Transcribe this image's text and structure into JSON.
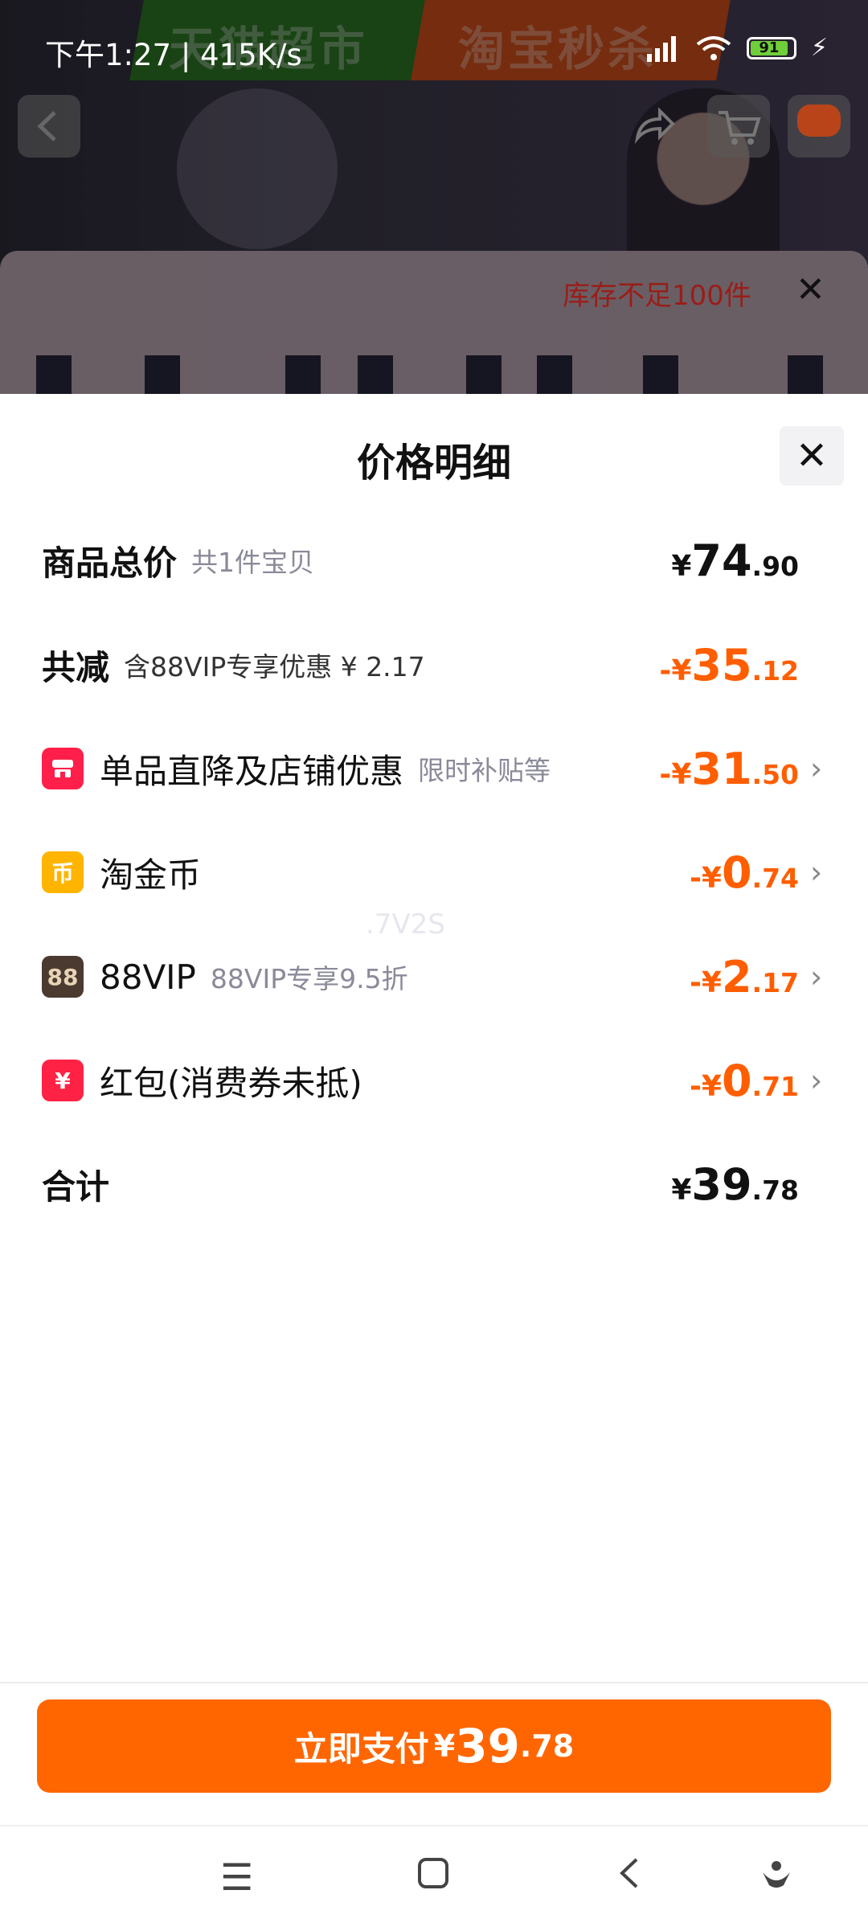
{
  "status": {
    "time": "下午1:27",
    "speed": "415K/s",
    "battery": "91"
  },
  "background": {
    "banner_left": "天猫超市",
    "banner_right": "淘宝秒杀",
    "sku_notice": "库存不足100件"
  },
  "sheet": {
    "title": "价格明细"
  },
  "rows": {
    "total": {
      "label": "商品总价",
      "sub": "共1件宝贝",
      "cur": "¥",
      "int": "74",
      "dec": ".90"
    },
    "discount": {
      "label": "共减",
      "sub": "含88VIP专享优惠 ¥ 2.17",
      "cur": "-¥",
      "int": "35",
      "dec": ".12"
    },
    "store": {
      "label": "单品直降及店铺优惠",
      "sub": "限时补贴等",
      "cur": "-¥",
      "int": "31",
      "dec": ".50"
    },
    "coin": {
      "label": "淘金币",
      "icon_text": "币",
      "cur": "-¥",
      "int": "0",
      "dec": ".74"
    },
    "vip": {
      "label": "88VIP",
      "sub": "88VIP专享9.5折",
      "icon_text": "88",
      "cur": "-¥",
      "int": "2",
      "dec": ".17"
    },
    "redpacket": {
      "label": "红包(消费券未抵)",
      "icon_text": "¥",
      "cur": "-¥",
      "int": "0",
      "dec": ".71"
    },
    "sum": {
      "label": "合计",
      "cur": "¥",
      "int": "39",
      "dec": ".78"
    }
  },
  "watermark": ".7V2S",
  "pay": {
    "label": "立即支付",
    "cur": "¥",
    "int": "39",
    "dec": ".78"
  },
  "colors": {
    "accent": "#ff6600",
    "discount": "#ff5e00"
  },
  "icons": [
    "back-icon",
    "share-icon",
    "cart-icon",
    "more-icon",
    "close-icon",
    "chevron-right-icon",
    "menu-icon",
    "home-icon",
    "nav-back-icon",
    "assistant-icon"
  ]
}
